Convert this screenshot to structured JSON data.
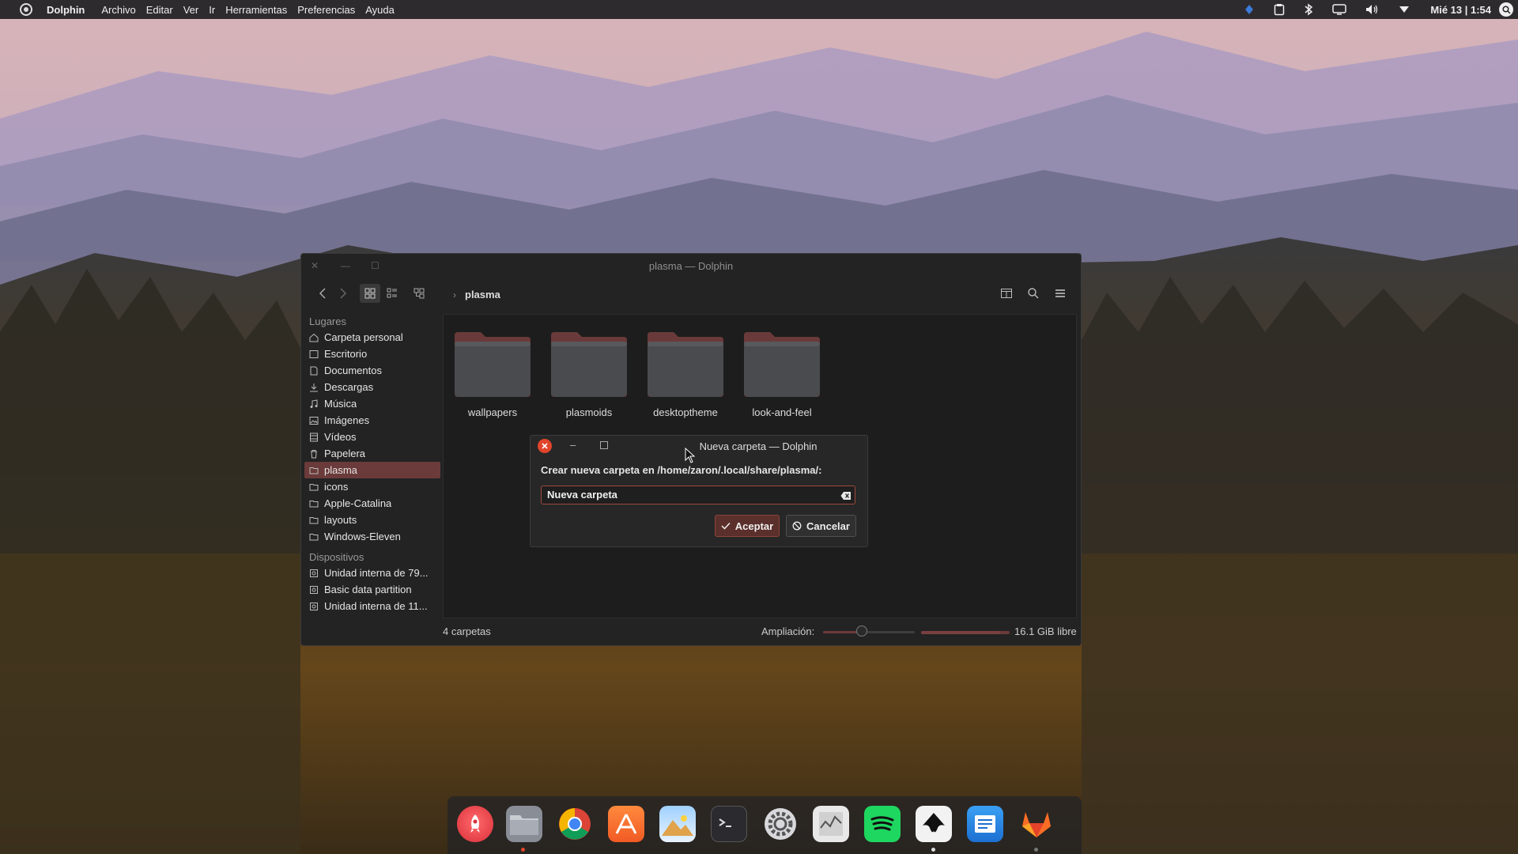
{
  "topbar": {
    "app_name": "Dolphin",
    "menu": [
      "Archivo",
      "Editar",
      "Ver",
      "Ir",
      "Herramientas",
      "Preferencias",
      "Ayuda"
    ],
    "clock": "Mié 13 | 1:54"
  },
  "window": {
    "title": "plasma — Dolphin",
    "breadcrumb": "plasma",
    "sidebar": {
      "places_heading": "Lugares",
      "places": [
        {
          "label": "Carpeta personal",
          "icon": "home-icon"
        },
        {
          "label": "Escritorio",
          "icon": "desktop-icon"
        },
        {
          "label": "Documentos",
          "icon": "documents-icon"
        },
        {
          "label": "Descargas",
          "icon": "downloads-icon"
        },
        {
          "label": "Música",
          "icon": "music-icon"
        },
        {
          "label": "Imágenes",
          "icon": "images-icon"
        },
        {
          "label": "Vídeos",
          "icon": "videos-icon"
        },
        {
          "label": "Papelera",
          "icon": "trash-icon"
        },
        {
          "label": "plasma",
          "icon": "folder-icon",
          "selected": true
        },
        {
          "label": "icons",
          "icon": "folder-icon"
        },
        {
          "label": "Apple-Catalina",
          "icon": "folder-icon"
        },
        {
          "label": "layouts",
          "icon": "folder-icon"
        },
        {
          "label": "Windows-Eleven",
          "icon": "folder-icon"
        }
      ],
      "devices_heading": "Dispositivos",
      "devices": [
        {
          "label": "Unidad interna de 79...",
          "icon": "drive-icon"
        },
        {
          "label": "Basic data partition",
          "icon": "drive-icon"
        },
        {
          "label": "Unidad interna de 11...",
          "icon": "drive-icon"
        }
      ]
    },
    "folders": [
      "wallpapers",
      "plasmoids",
      "desktoptheme",
      "look-and-feel"
    ],
    "status": {
      "count": "4 carpetas",
      "zoom_label": "Ampliación:",
      "free_space": "16.1 GiB libre"
    }
  },
  "dialog": {
    "title": "Nueva carpeta — Dolphin",
    "prompt": "Crear nueva carpeta en /home/zaron/.local/share/plasma/:",
    "input_value": "Nueva carpeta",
    "ok_label": "Aceptar",
    "cancel_label": "Cancelar"
  },
  "colors": {
    "accent": "#6b3a3a",
    "close_button": "#e0452b"
  },
  "dock": {
    "apps": [
      "launchpad-icon",
      "files-icon",
      "chrome-icon",
      "appstore-icon",
      "photos-icon",
      "terminal-icon",
      "settings-icon",
      "system-monitor-icon",
      "spotify-icon",
      "inkscape-icon",
      "text-editor-icon",
      "gitlab-icon"
    ]
  }
}
